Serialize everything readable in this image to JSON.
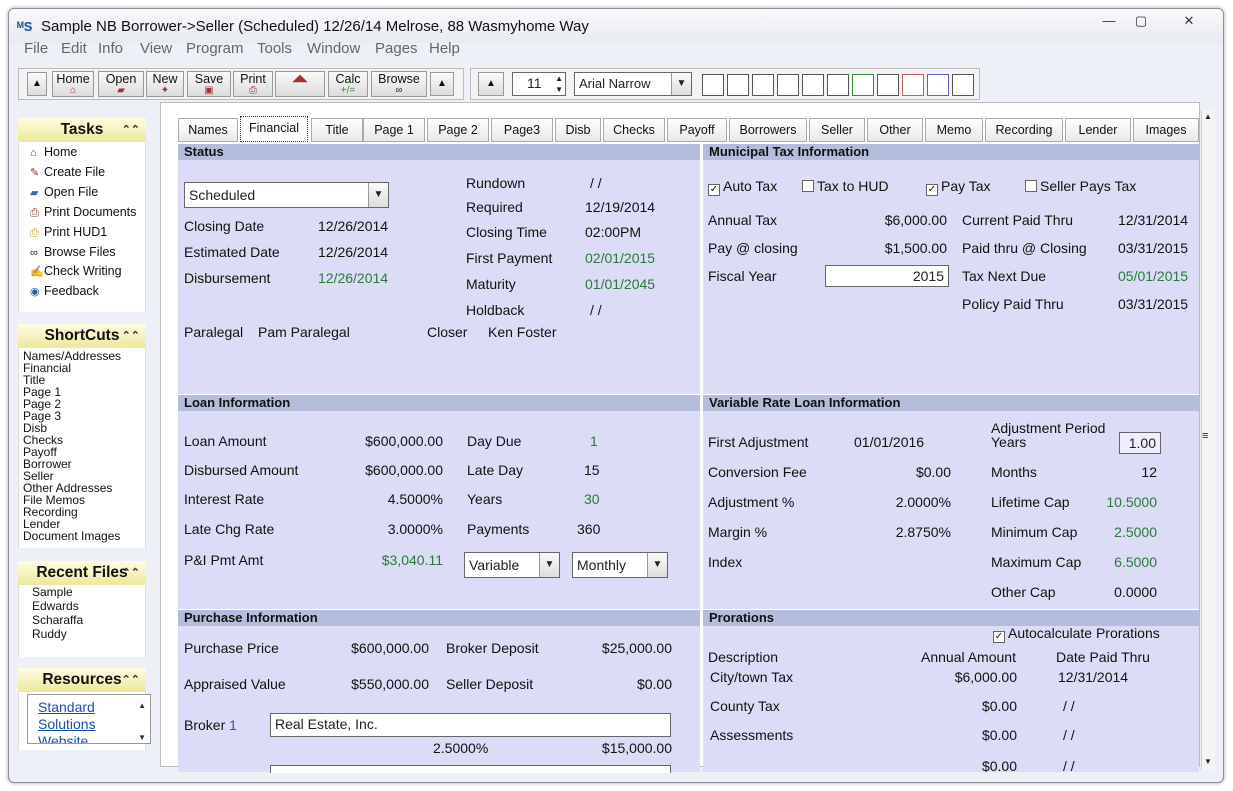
{
  "window": {
    "title": "Sample NB Borrower->Seller (Scheduled) 12/26/14 Melrose, 88 Wasmyhome Way",
    "icon": "app-logo-icon",
    "min": "—",
    "max": "▢",
    "close": "✕"
  },
  "menu": [
    "File",
    "Edit",
    "Info",
    "View",
    "Program",
    "Tools",
    "Window",
    "Pages",
    "Help"
  ],
  "toolbar": {
    "buttons": [
      "Home",
      "Open",
      "New",
      "Save",
      "Print",
      "Calc",
      "Browse"
    ],
    "font_size": "11",
    "font_name": "Arial Narrow"
  },
  "tasks": {
    "title": "Tasks",
    "items": [
      "Home",
      "Create File",
      "Open File",
      "Print Documents",
      "Print HUD1",
      "Browse Files",
      "Check Writing",
      "Feedback"
    ]
  },
  "shortcuts": {
    "title": "ShortCuts",
    "items": [
      "Names/Addresses",
      "Financial",
      "Title",
      "Page 1",
      "Page 2",
      "Page 3",
      "Disb",
      "Checks",
      "Payoff",
      "Borrower",
      "Seller",
      "Other Addresses",
      "File Memos",
      "Recording",
      "Lender",
      "Document Images"
    ]
  },
  "recent": {
    "title": "Recent Files",
    "items": [
      "Sample",
      "Edwards",
      "Scharaffa",
      "Ruddy"
    ]
  },
  "resources": {
    "title": "Resources",
    "link": [
      "Standard",
      "Solutions",
      "Website"
    ]
  },
  "tabs": [
    "Names",
    "Financial",
    "Title",
    "Page 1",
    "Page 2",
    "Page3",
    "Disb",
    "Checks",
    "Payoff",
    "Borrowers",
    "Seller",
    "Other",
    "Memo",
    "Recording",
    "Lender",
    "Images"
  ],
  "status": {
    "title": "Status",
    "status_value": "Scheduled",
    "closing_date_label": "Closing Date",
    "closing_date": "12/26/2014",
    "estimated_date_label": "Estimated Date",
    "estimated_date": "12/26/2014",
    "disbursement_label": "Disbursement",
    "disbursement": "12/26/2014",
    "rundown_label": "Rundown",
    "rundown": "/ /",
    "required_label": "Required",
    "required": "12/19/2014",
    "closing_time_label": "Closing Time",
    "closing_time": "02:00PM",
    "first_payment_label": "First Payment",
    "first_payment": "02/01/2015",
    "maturity_label": "Maturity",
    "maturity": "01/01/2045",
    "holdback_label": "Holdback",
    "holdback": "/ /",
    "paralegal_label": "Paralegal",
    "paralegal": "Pam Paralegal",
    "closer_label": "Closer",
    "closer": "Ken Foster"
  },
  "tax": {
    "title": "Municipal Tax Information",
    "auto_tax": "Auto Tax",
    "tax_to_hud": "Tax to HUD",
    "pay_tax": "Pay Tax",
    "seller_pays": "Seller Pays Tax",
    "annual_tax_label": "Annual Tax",
    "annual_tax": "$6,000.00",
    "pay_closing_label": "Pay @ closing",
    "pay_closing": "$1,500.00",
    "fiscal_year_label": "Fiscal Year",
    "fiscal_year": "2015",
    "current_paid_label": "Current Paid Thru",
    "current_paid": "12/31/2014",
    "paid_thru_closing_label": "Paid thru @ Closing",
    "paid_thru_closing": "03/31/2015",
    "tax_next_due_label": "Tax Next Due",
    "tax_next_due": "05/01/2015",
    "policy_paid_label": "Policy Paid Thru",
    "policy_paid": "03/31/2015"
  },
  "loan": {
    "title": "Loan Information",
    "loan_amount_label": "Loan Amount",
    "loan_amount": "$600,000.00",
    "disbursed_label": "Disbursed Amount",
    "disbursed": "$600,000.00",
    "interest_label": "Interest Rate",
    "interest": "4.5000%",
    "late_chg_label": "Late Chg Rate",
    "late_chg": "3.0000%",
    "pi_label": "P&I Pmt Amt",
    "pi": "$3,040.11",
    "day_due_label": "Day Due",
    "day_due": "1",
    "late_day_label": "Late Day",
    "late_day": "15",
    "years_label": "Years",
    "years": "30",
    "payments_label": "Payments",
    "payments": "360",
    "rate_type": "Variable",
    "frequency": "Monthly"
  },
  "variable": {
    "title": "Variable Rate Loan Information",
    "first_adj_label": "First Adjustment",
    "first_adj": "01/01/2016",
    "conversion_label": "Conversion Fee",
    "conversion": "$0.00",
    "adj_pct_label": "Adjustment %",
    "adj_pct": "2.0000%",
    "margin_label": "Margin %",
    "margin": "2.8750%",
    "index_label": "Index",
    "adj_period_label": "Adjustment Period",
    "adj_period_years_label": "Years",
    "adj_period_years": "1.00",
    "months_label": "Months",
    "months": "12",
    "lifetime_label": "Lifetime Cap",
    "lifetime": "10.5000",
    "min_cap_label": "Minimum Cap",
    "min_cap": "2.5000",
    "max_cap_label": "Maximum Cap",
    "max_cap": "6.5000",
    "other_cap_label": "Other Cap",
    "other_cap": "0.0000"
  },
  "purchase": {
    "title": "Purchase Information",
    "price_label": "Purchase Price",
    "price": "$600,000.00",
    "appraised_label": "Appraised Value",
    "appraised": "$550,000.00",
    "broker_dep_label": "Broker Deposit",
    "broker_dep": "$25,000.00",
    "seller_dep_label": "Seller Deposit",
    "seller_dep": "$0.00",
    "broker1_label": "Broker",
    "broker1_num": "1",
    "broker1": "Real Estate, Inc.",
    "broker1_pct": "2.5000%",
    "broker1_amt": "$15,000.00"
  },
  "prorations": {
    "title": "Prorations",
    "autocalc": "Autocalculate Prorations",
    "col_desc": "Description",
    "col_amount": "Annual Amount",
    "col_date": "Date Paid Thru",
    "rows": [
      {
        "desc": "City/town Tax",
        "amount": "$6,000.00",
        "date": "12/31/2014"
      },
      {
        "desc": "County Tax",
        "amount": "$0.00",
        "date": "/ /"
      },
      {
        "desc": "Assessments",
        "amount": "$0.00",
        "date": "/ /"
      },
      {
        "desc": "",
        "amount": "$0.00",
        "date": "/ /"
      }
    ]
  }
}
